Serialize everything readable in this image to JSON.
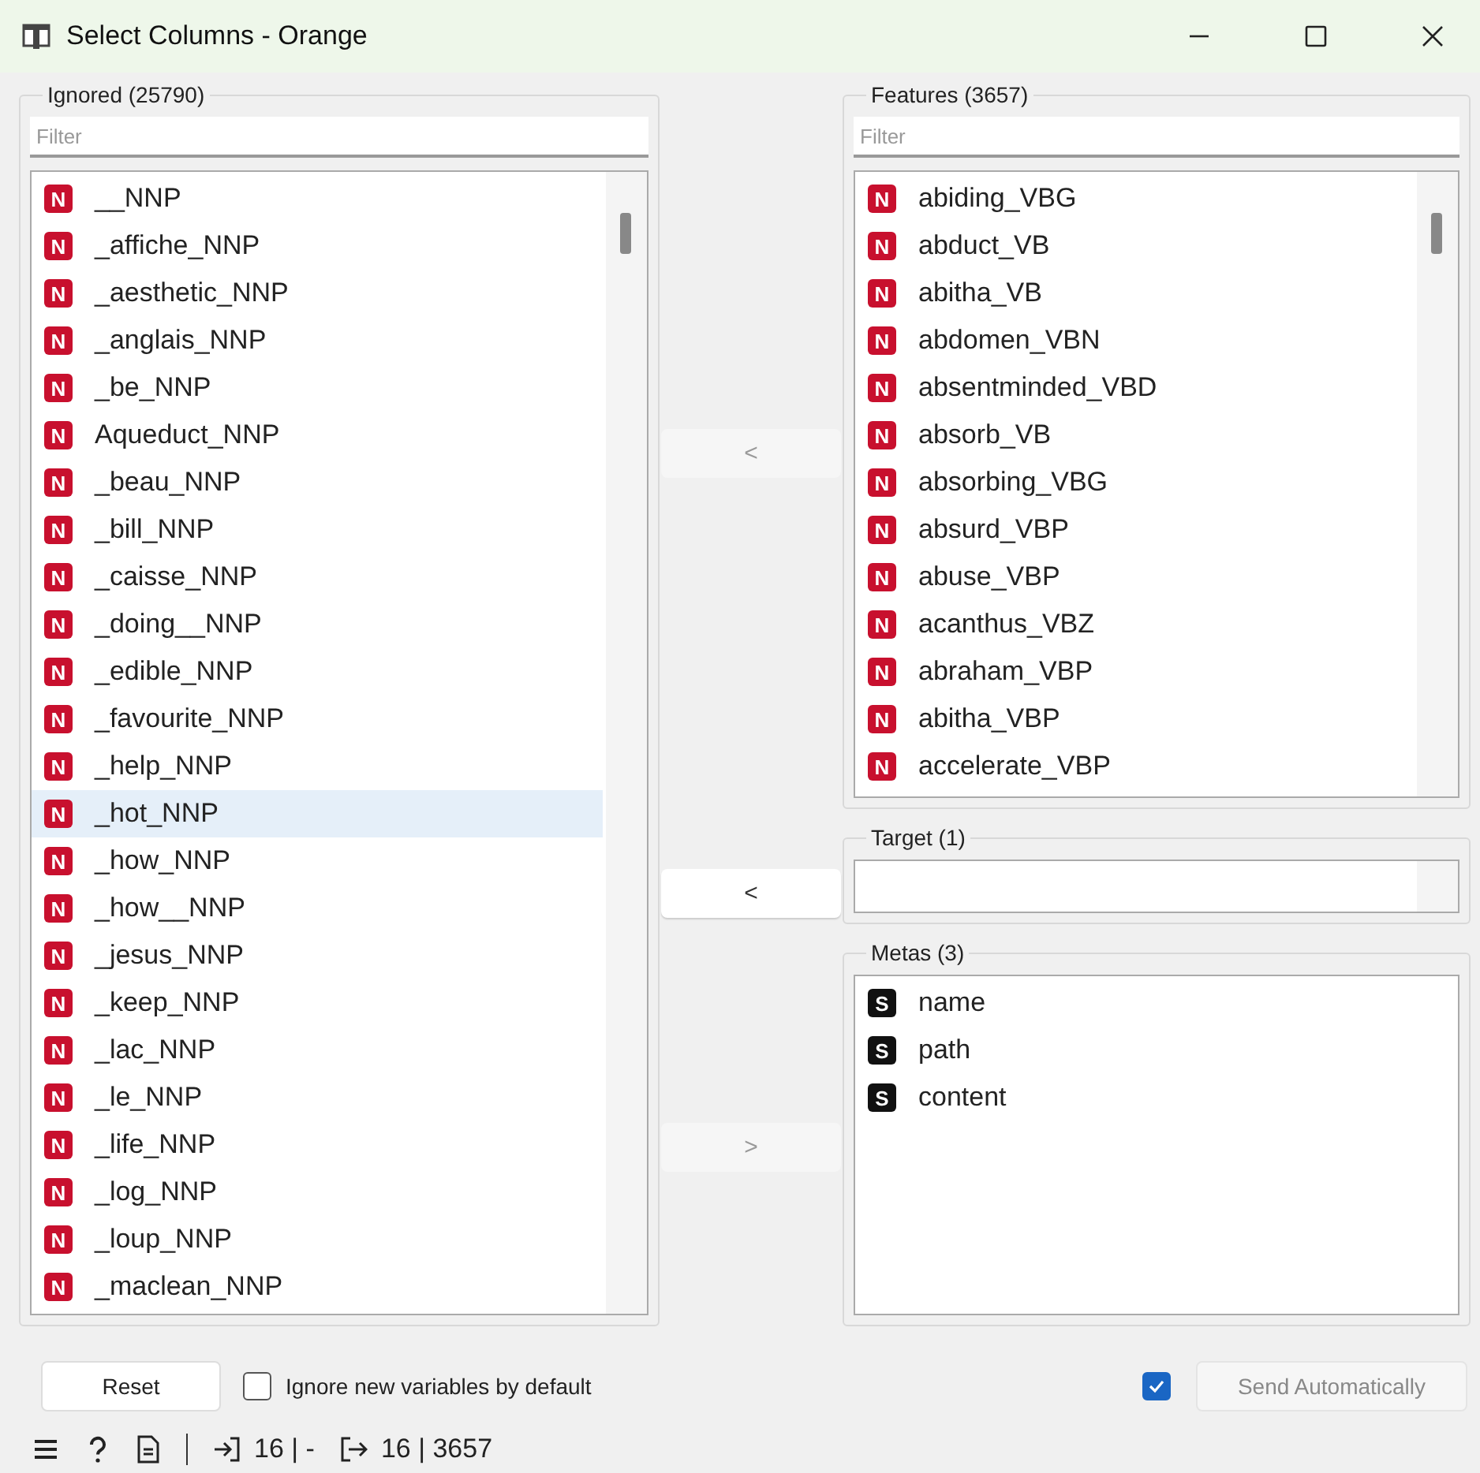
{
  "window": {
    "title": "Select Columns - Orange"
  },
  "ignored": {
    "title": "Ignored (25790)",
    "filter": {
      "placeholder": "Filter"
    },
    "items": [
      {
        "badge": "N",
        "label": "__NNP",
        "selected": false
      },
      {
        "badge": "N",
        "label": "_affiche_NNP",
        "selected": false
      },
      {
        "badge": "N",
        "label": "_aesthetic_NNP",
        "selected": false
      },
      {
        "badge": "N",
        "label": "_anglais_NNP",
        "selected": false
      },
      {
        "badge": "N",
        "label": "_be_NNP",
        "selected": false
      },
      {
        "badge": "N",
        "label": "Aqueduct_NNP",
        "selected": false
      },
      {
        "badge": "N",
        "label": "_beau_NNP",
        "selected": false
      },
      {
        "badge": "N",
        "label": "_bill_NNP",
        "selected": false
      },
      {
        "badge": "N",
        "label": "_caisse_NNP",
        "selected": false
      },
      {
        "badge": "N",
        "label": "_doing__NNP",
        "selected": false
      },
      {
        "badge": "N",
        "label": "_edible_NNP",
        "selected": false
      },
      {
        "badge": "N",
        "label": "_favourite_NNP",
        "selected": false
      },
      {
        "badge": "N",
        "label": "_help_NNP",
        "selected": false
      },
      {
        "badge": "N",
        "label": "_hot_NNP",
        "selected": true
      },
      {
        "badge": "N",
        "label": "_how_NNP",
        "selected": false
      },
      {
        "badge": "N",
        "label": "_how__NNP",
        "selected": false
      },
      {
        "badge": "N",
        "label": "_jesus_NNP",
        "selected": false
      },
      {
        "badge": "N",
        "label": "_keep_NNP",
        "selected": false
      },
      {
        "badge": "N",
        "label": "_lac_NNP",
        "selected": false
      },
      {
        "badge": "N",
        "label": "_le_NNP",
        "selected": false
      },
      {
        "badge": "N",
        "label": "_life_NNP",
        "selected": false
      },
      {
        "badge": "N",
        "label": "_log_NNP",
        "selected": false
      },
      {
        "badge": "N",
        "label": "_loup_NNP",
        "selected": false
      },
      {
        "badge": "N",
        "label": "_maclean_NNP",
        "selected": false
      }
    ]
  },
  "move_buttons": [
    {
      "label": "<",
      "disabled": true
    },
    {
      "label": "<",
      "disabled": false
    },
    {
      "label": ">",
      "disabled": true
    }
  ],
  "features": {
    "title": "Features (3657)",
    "filter": {
      "placeholder": "Filter"
    },
    "items": [
      {
        "badge": "N",
        "label": "abiding_VBG",
        "selected": false
      },
      {
        "badge": "N",
        "label": "abduct_VB",
        "selected": false
      },
      {
        "badge": "N",
        "label": "abitha_VB",
        "selected": false
      },
      {
        "badge": "N",
        "label": "abdomen_VBN",
        "selected": false
      },
      {
        "badge": "N",
        "label": "absentminded_VBD",
        "selected": false
      },
      {
        "badge": "N",
        "label": "absorb_VB",
        "selected": false
      },
      {
        "badge": "N",
        "label": "absorbing_VBG",
        "selected": false
      },
      {
        "badge": "N",
        "label": "absurd_VBP",
        "selected": false
      },
      {
        "badge": "N",
        "label": "abuse_VBP",
        "selected": false
      },
      {
        "badge": "N",
        "label": "acanthus_VBZ",
        "selected": false
      },
      {
        "badge": "N",
        "label": "abraham_VBP",
        "selected": false
      },
      {
        "badge": "N",
        "label": "abitha_VBP",
        "selected": false
      },
      {
        "badge": "N",
        "label": "accelerate_VBP",
        "selected": false
      }
    ]
  },
  "target": {
    "title": "Target (1)"
  },
  "metas": {
    "title": "Metas (3)",
    "items": [
      {
        "badge": "S",
        "label": "name",
        "selected": false
      },
      {
        "badge": "S",
        "label": "path",
        "selected": false
      },
      {
        "badge": "S",
        "label": "content",
        "selected": false
      }
    ]
  },
  "reset_button": "Reset",
  "ignore_new": {
    "label": "Ignore new variables by default",
    "checked": false
  },
  "send_auto": {
    "checked": true,
    "label": "Send Automatically",
    "disabled": true
  },
  "status_bar": {
    "input": "16 | -",
    "output": "16 | 3657"
  }
}
